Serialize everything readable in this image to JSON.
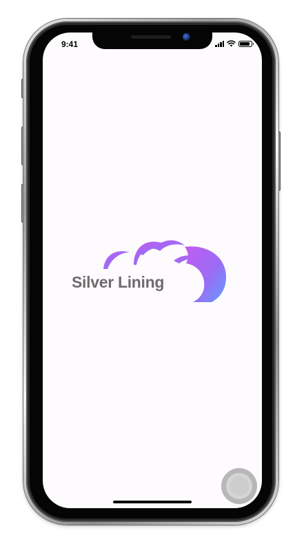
{
  "status_bar": {
    "time": "9:41",
    "icons": [
      "cellular-signal-icon",
      "wifi-icon",
      "battery-icon"
    ],
    "battery_level": 0.9
  },
  "splash": {
    "app_name": "Silver Lining",
    "logo_icon": "cloud-logo-icon",
    "gradient_colors": [
      "#c05cf0",
      "#9b6cf6",
      "#5aa2ff"
    ],
    "text_color": "#6e6a6e"
  },
  "assistive_touch": {
    "icon": "assistive-touch-icon"
  }
}
